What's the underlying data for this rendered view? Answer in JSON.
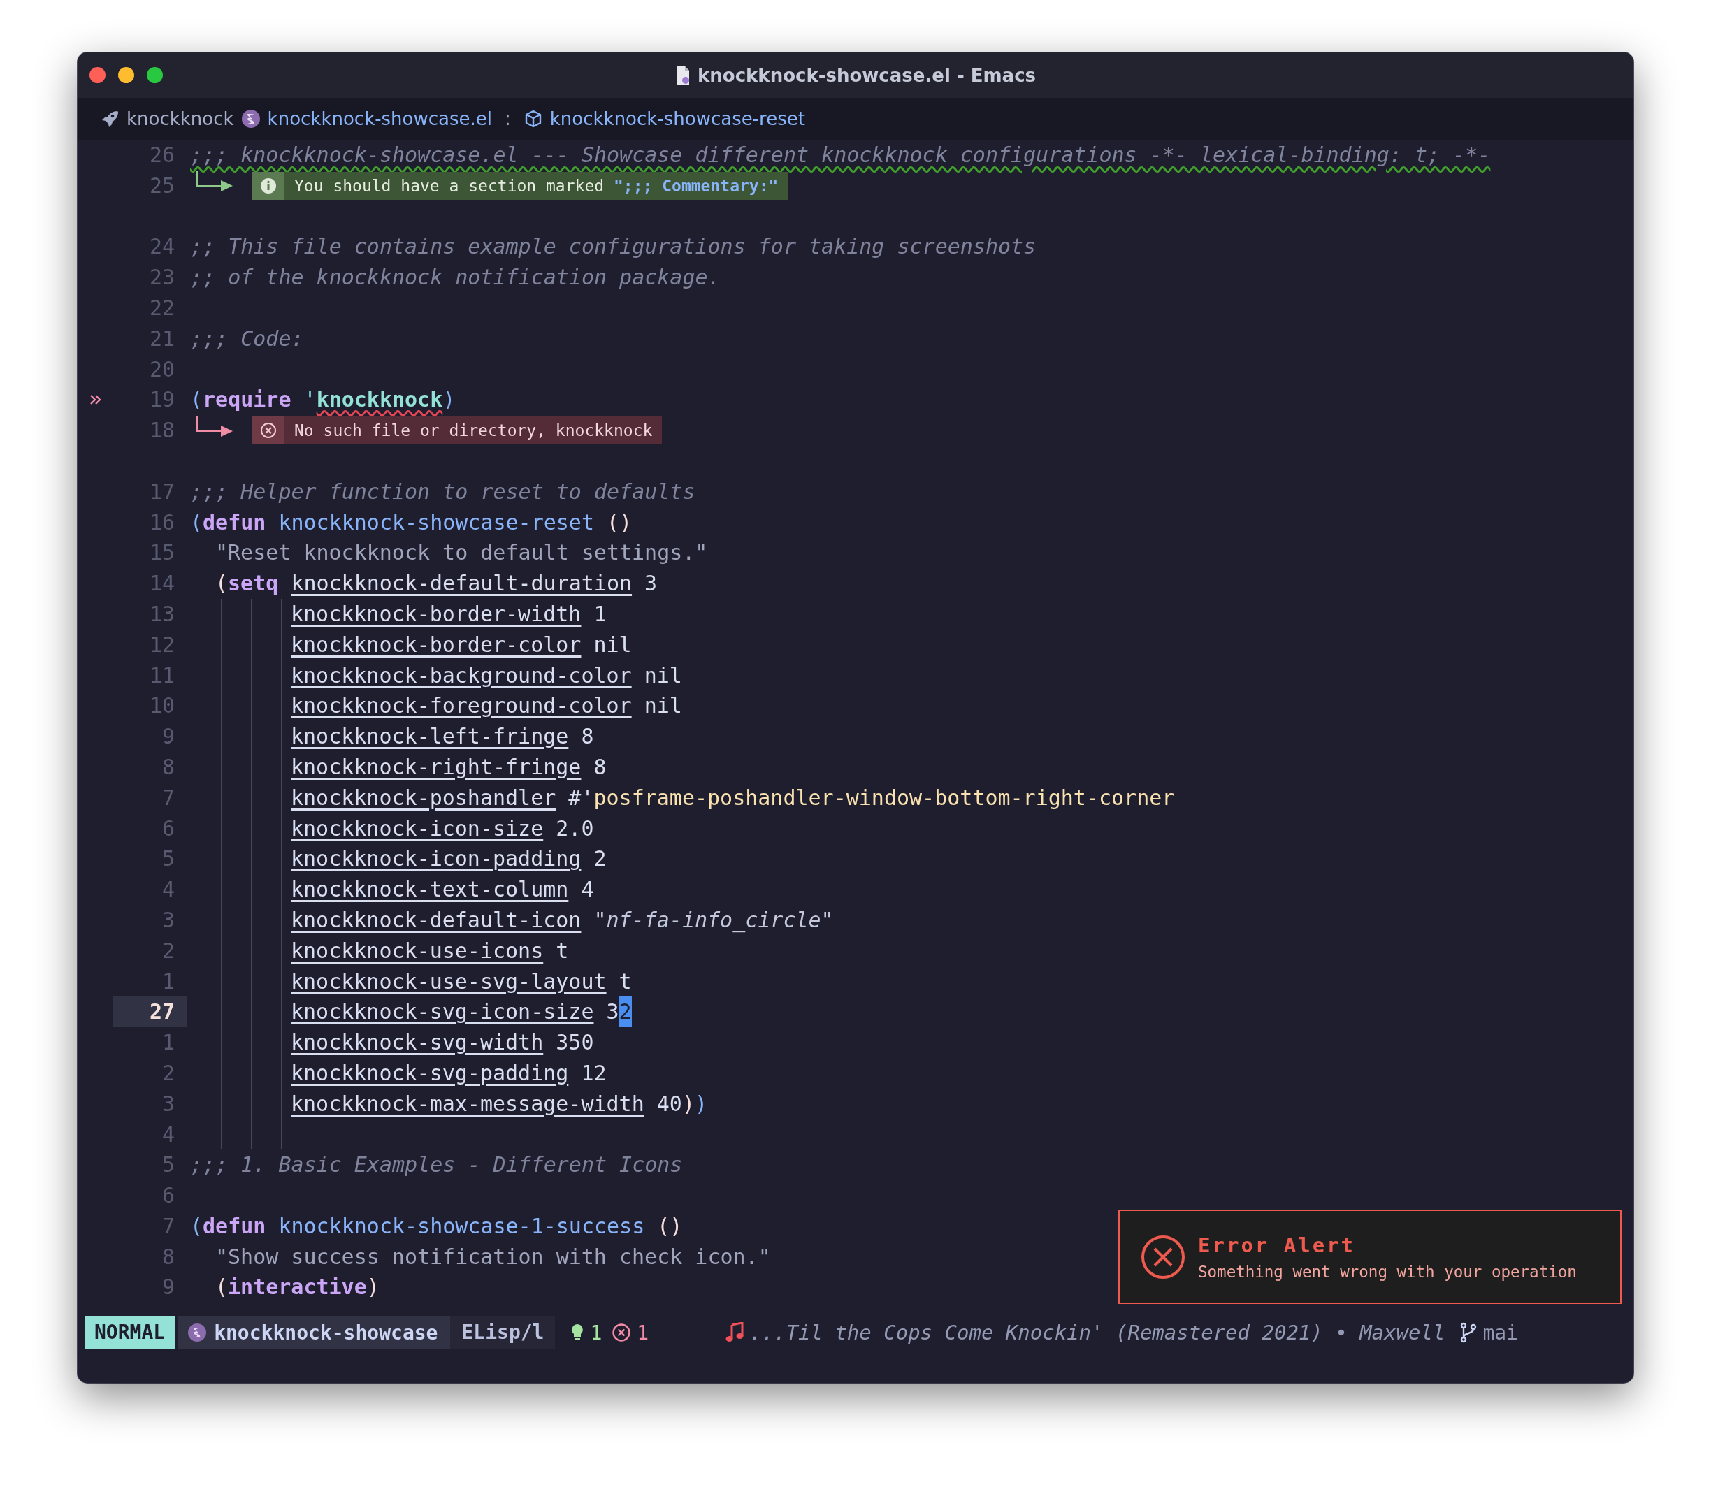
{
  "window": {
    "title": "knockknock-showcase.el - Emacs"
  },
  "breadcrumb": [
    {
      "kind": "project",
      "label": "knockknock"
    },
    {
      "kind": "file",
      "label": "knockknock-showcase.el"
    },
    {
      "kind": "separator",
      "label": ":"
    },
    {
      "kind": "function",
      "label": "knockknock-showcase-reset"
    }
  ],
  "lines": [
    {
      "kind": "top",
      "number": "26",
      "current": false,
      "marker": false,
      "tokens": [
        {
          "text": ";;; knockknock-showcase.el --- Showcase different knockknock configurations -*- lexical-binding: t; -*-",
          "kind": "comment-warn"
        }
      ]
    },
    {
      "kind": "info-note",
      "number": "25",
      "text": "You should have a section marked **\";;; Commentary:\"**"
    },
    {
      "kind": "gap"
    },
    {
      "kind": "top",
      "number": "24",
      "current": false,
      "marker": false,
      "tokens": [
        {
          "text": ";; This file contains example configurations for taking screenshots",
          "kind": "comment"
        }
      ]
    },
    {
      "kind": "top",
      "number": "23",
      "current": false,
      "marker": false,
      "tokens": [
        {
          "text": ";; of the knockknock notification package.",
          "kind": "comment"
        }
      ]
    },
    {
      "kind": "top",
      "number": "22",
      "current": false,
      "marker": false
    },
    {
      "kind": "top",
      "number": "21",
      "current": false,
      "marker": false,
      "tokens": [
        {
          "text": ";;; Code:",
          "kind": "comment"
        }
      ]
    },
    {
      "kind": "top",
      "number": "20",
      "current": false,
      "marker": false
    },
    {
      "kind": "top",
      "number": "19",
      "current": false,
      "marker": true,
      "tokens": [
        {
          "text": "(",
          "kind": "paren-outer"
        },
        {
          "text": "require",
          "kind": "keyword"
        },
        {
          "text": " '",
          "kind": "quote"
        },
        {
          "text": "knockknock",
          "kind": "symbol-error"
        },
        {
          "text": ")",
          "kind": "paren-outer"
        }
      ]
    },
    {
      "kind": "error-note",
      "number": "18",
      "text": "No such file or directory, knockknock"
    },
    {
      "kind": "gap"
    },
    {
      "kind": "top",
      "number": "17",
      "current": false,
      "marker": false,
      "tokens": [
        {
          "text": ";;; Helper function to reset to defaults",
          "kind": "comment"
        }
      ]
    },
    {
      "kind": "top",
      "number": "16",
      "current": false,
      "marker": false,
      "tokens": [
        {
          "text": "(",
          "kind": "paren-outer"
        },
        {
          "text": "defun",
          "kind": "keyword"
        },
        {
          "text": " knockknock-showcase-reset",
          "kind": "function"
        },
        {
          "text": " ()",
          "kind": "paren-inner"
        }
      ]
    },
    {
      "kind": "form",
      "number": "15",
      "current": false,
      "marker": false,
      "tokens": [
        {
          "text": "\"Reset knockknock to default settings.\"",
          "kind": "doc"
        }
      ]
    },
    {
      "kind": "form",
      "number": "14",
      "current": false,
      "marker": false,
      "tokens": [
        {
          "text": "(",
          "kind": "paren-inner"
        },
        {
          "text": "setq ",
          "kind": "keyword"
        },
        {
          "text": "knockknock-default-duration",
          "kind": "variable"
        },
        {
          "text": " 3",
          "kind": "value"
        }
      ]
    },
    {
      "kind": "body",
      "number": "13",
      "current": false,
      "marker": false,
      "tokens": [
        {
          "text": "knockknock-border-width",
          "kind": "variable"
        },
        {
          "text": " 1",
          "kind": "value"
        }
      ]
    },
    {
      "kind": "body",
      "number": "12",
      "current": false,
      "marker": false,
      "tokens": [
        {
          "text": "knockknock-border-color",
          "kind": "variable"
        },
        {
          "text": " nil",
          "kind": "value"
        }
      ]
    },
    {
      "kind": "body",
      "number": "11",
      "current": false,
      "marker": false,
      "tokens": [
        {
          "text": "knockknock-background-color",
          "kind": "variable"
        },
        {
          "text": " nil",
          "kind": "value"
        }
      ]
    },
    {
      "kind": "body",
      "number": "10",
      "current": false,
      "marker": false,
      "tokens": [
        {
          "text": "knockknock-foreground-color",
          "kind": "variable"
        },
        {
          "text": " nil",
          "kind": "value"
        }
      ]
    },
    {
      "kind": "body",
      "number": "9",
      "current": false,
      "marker": false,
      "tokens": [
        {
          "text": "knockknock-left-fringe",
          "kind": "variable"
        },
        {
          "text": " 8",
          "kind": "value"
        }
      ]
    },
    {
      "kind": "body",
      "number": "8",
      "current": false,
      "marker": false,
      "tokens": [
        {
          "text": "knockknock-right-fringe",
          "kind": "variable"
        },
        {
          "text": " 8",
          "kind": "value"
        }
      ]
    },
    {
      "kind": "body",
      "number": "7",
      "current": false,
      "marker": false,
      "tokens": [
        {
          "text": "knockknock-poshandler",
          "kind": "variable"
        },
        {
          "text": " #'",
          "kind": "value"
        },
        {
          "text": "posframe-poshandler-window-bottom-right-corner",
          "kind": "function-quote"
        }
      ]
    },
    {
      "kind": "body",
      "number": "6",
      "current": false,
      "marker": false,
      "tokens": [
        {
          "text": "knockknock-icon-size",
          "kind": "variable"
        },
        {
          "text": " 2.0",
          "kind": "value"
        }
      ]
    },
    {
      "kind": "body",
      "number": "5",
      "current": false,
      "marker": false,
      "tokens": [
        {
          "text": "knockknock-icon-padding",
          "kind": "variable"
        },
        {
          "text": " 2",
          "kind": "value"
        }
      ]
    },
    {
      "kind": "body",
      "number": "4",
      "current": false,
      "marker": false,
      "tokens": [
        {
          "text": "knockknock-text-column",
          "kind": "variable"
        },
        {
          "text": " 4",
          "kind": "value"
        }
      ]
    },
    {
      "kind": "body",
      "number": "3",
      "current": false,
      "marker": false,
      "tokens": [
        {
          "text": "knockknock-default-icon",
          "kind": "variable"
        },
        {
          "text": " \"nf-fa-info_circle\"",
          "kind": "string"
        }
      ]
    },
    {
      "kind": "body",
      "number": "2",
      "current": false,
      "marker": false,
      "tokens": [
        {
          "text": "knockknock-use-icons",
          "kind": "variable"
        },
        {
          "text": " t",
          "kind": "value"
        }
      ]
    },
    {
      "kind": "body",
      "number": "1",
      "current": false,
      "marker": false,
      "tokens": [
        {
          "text": "knockknock-use-svg-layout",
          "kind": "variable"
        },
        {
          "text": " t",
          "kind": "value"
        }
      ]
    },
    {
      "kind": "body",
      "number": "27",
      "current": true,
      "marker": false,
      "tokens": [
        {
          "text": "knockknock-svg-icon-size",
          "kind": "variable"
        },
        {
          "text": " 3",
          "kind": "value"
        },
        {
          "text": "2",
          "kind": "cursor"
        }
      ]
    },
    {
      "kind": "body",
      "number": "1",
      "current": false,
      "marker": false,
      "tokens": [
        {
          "text": "knockknock-svg-width",
          "kind": "variable"
        },
        {
          "text": " 350",
          "kind": "value"
        }
      ]
    },
    {
      "kind": "body",
      "number": "2",
      "current": false,
      "marker": false,
      "tokens": [
        {
          "text": "knockknock-svg-padding",
          "kind": "variable"
        },
        {
          "text": " 12",
          "kind": "value"
        }
      ]
    },
    {
      "kind": "body",
      "number": "3",
      "current": false,
      "marker": false,
      "tokens": [
        {
          "text": "knockknock-max-message-width",
          "kind": "variable"
        },
        {
          "text": " 40",
          "kind": "value"
        },
        {
          "text": ")",
          "kind": "paren-inner"
        },
        {
          "text": ")",
          "kind": "paren-outer"
        }
      ]
    },
    {
      "kind": "body",
      "number": "4",
      "current": false,
      "marker": false
    },
    {
      "kind": "top",
      "number": "5",
      "current": false,
      "marker": false,
      "tokens": [
        {
          "text": ";;; 1. Basic Examples - Different Icons",
          "kind": "comment"
        }
      ]
    },
    {
      "kind": "top",
      "number": "6",
      "current": false,
      "marker": false
    },
    {
      "kind": "top",
      "number": "7",
      "current": false,
      "marker": false,
      "tokens": [
        {
          "text": "(",
          "kind": "paren-outer"
        },
        {
          "text": "defun",
          "kind": "keyword"
        },
        {
          "text": " knockknock-showcase-1-success",
          "kind": "function"
        },
        {
          "text": " ()",
          "kind": "paren-inner"
        }
      ]
    },
    {
      "kind": "form",
      "number": "8",
      "current": false,
      "marker": false,
      "tokens": [
        {
          "text": "\"Show success notification with check icon.\"",
          "kind": "doc"
        }
      ]
    },
    {
      "kind": "form",
      "number": "9",
      "current": false,
      "marker": false,
      "tokens": [
        {
          "text": "(",
          "kind": "paren-inner"
        },
        {
          "text": "interactive",
          "kind": "keyword"
        },
        {
          "text": ")",
          "kind": "paren-inner"
        }
      ]
    }
  ],
  "alert": {
    "title": "Error Alert",
    "message": "Something went wrong with your operation"
  },
  "status_bar": {
    "mode": "NORMAL",
    "buffer": "knockknock-showcase",
    "major_mode": "ELisp/l",
    "warnings": "1",
    "errors": "1",
    "now_playing": "...Til the Cops Come Knockin' (Remastered 2021) • Maxwell",
    "branch": "mai"
  }
}
